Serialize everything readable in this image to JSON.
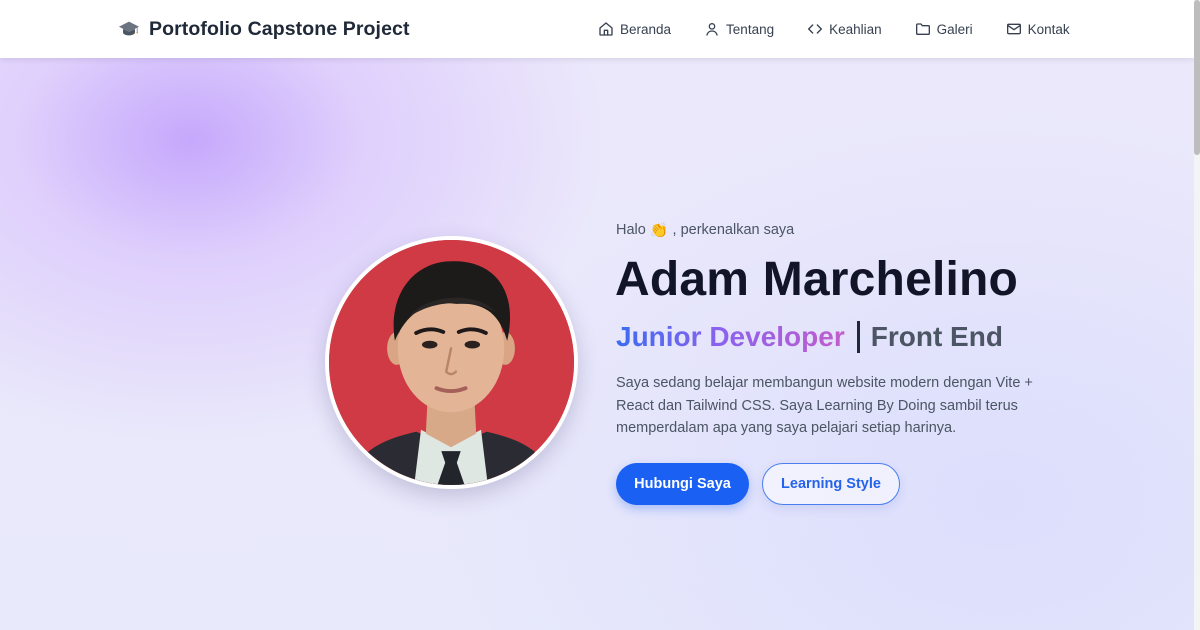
{
  "brand": {
    "icon": "graduation-cap-icon",
    "title": "Portofolio Capstone Project"
  },
  "nav": {
    "items": [
      {
        "label": "Beranda",
        "icon": "home-icon"
      },
      {
        "label": "Tentang",
        "icon": "user-icon"
      },
      {
        "label": "Keahlian",
        "icon": "code-icon"
      },
      {
        "label": "Galeri",
        "icon": "folder-icon"
      },
      {
        "label": "Kontak",
        "icon": "mail-icon"
      }
    ]
  },
  "hero": {
    "greeting_prefix": "Halo",
    "wave_emoji": "👏",
    "greeting_suffix": ", perkenalkan saya",
    "name": "Adam Marchelino",
    "role_main": "Junior Developer",
    "role_extra": "Front End",
    "bio": "Saya sedang belajar membangun website modern dengan Vite + React dan Tailwind CSS. Saya Learning By Doing sambil terus memperdalam apa yang saya pelajari setiap harinya.",
    "primary_button": "Hubungi Saya",
    "secondary_button": "Learning Style"
  },
  "colors": {
    "primary": "#1a60f2",
    "heading": "#121528",
    "photo_background": "#cf3a44"
  }
}
